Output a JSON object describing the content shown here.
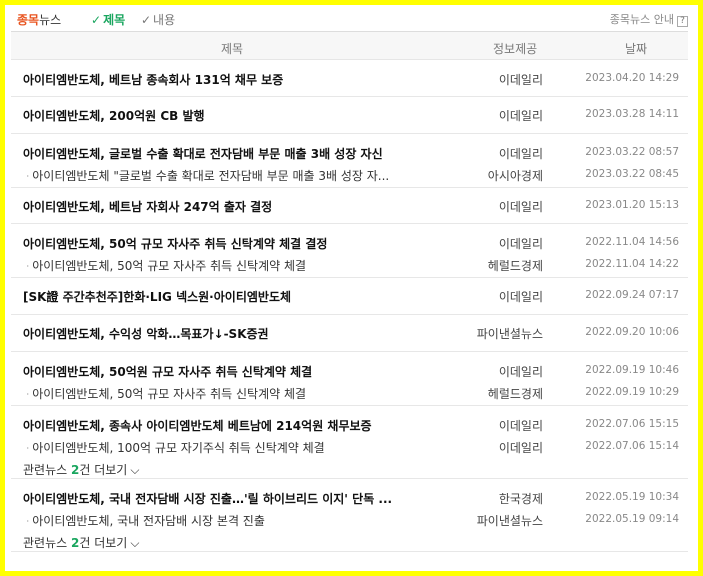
{
  "header": {
    "brand_strong": "종목",
    "brand_rest": "뉴스",
    "tabs": [
      {
        "label": "제목",
        "active": true
      },
      {
        "label": "내용",
        "active": false
      }
    ],
    "help_label": "종목뉴스 안내",
    "help_icon": "?"
  },
  "columns": {
    "title": "제목",
    "source": "정보제공",
    "date": "날짜"
  },
  "more_prefix": "관련뉴스",
  "more_suffix": "건 더보기",
  "chevron": "⌵",
  "sub_marker": "└",
  "check": "✓",
  "news": [
    {
      "title": "아이티엠반도체, 베트남 종속회사 131억 채무 보증",
      "source": "이데일리",
      "date": "2023.04.20 14:29",
      "related": [],
      "more": null
    },
    {
      "title": "아이티엠반도체, 200억원 CB 발행",
      "source": "이데일리",
      "date": "2023.03.28 14:11",
      "related": [],
      "more": null
    },
    {
      "title": "아이티엠반도체, 글로벌 수출 확대로 전자담배 부문 매출 3배 성장 자신",
      "source": "이데일리",
      "date": "2023.03.22 08:57",
      "related": [
        {
          "title": "아이티엠반도체 \"글로벌 수출 확대로 전자담배 부문 매출 3배 성장 자...",
          "source": "아시아경제",
          "date": "2023.03.22 08:45"
        }
      ],
      "more": null
    },
    {
      "title": "아이티엠반도체, 베트남 자회사 247억 출자 결정",
      "source": "이데일리",
      "date": "2023.01.20 15:13",
      "related": [],
      "more": null
    },
    {
      "title": "아이티엠반도체, 50억 규모 자사주 취득 신탁계약 체결 결정",
      "source": "이데일리",
      "date": "2022.11.04 14:56",
      "related": [
        {
          "title": "아이티엠반도체, 50억 규모 자사주 취득 신탁계약 체결",
          "source": "헤럴드경제",
          "date": "2022.11.04 14:22"
        }
      ],
      "more": null
    },
    {
      "title": "[SK證 주간추천주]한화·LIG 넥스원·아이티엠반도체",
      "source": "이데일리",
      "date": "2022.09.24 07:17",
      "related": [],
      "more": null
    },
    {
      "title": "아이티엠반도체, 수익성 악화…목표가↓-SK증권",
      "source": "파이낸셜뉴스",
      "date": "2022.09.20 10:06",
      "related": [],
      "more": null
    },
    {
      "title": "아이티엠반도체, 50억원 규모 자사주 취득 신탁계약 체결",
      "source": "이데일리",
      "date": "2022.09.19 10:46",
      "related": [
        {
          "title": "아이티엠반도체, 50억 규모 자사주 취득 신탁계약 체결",
          "source": "헤럴드경제",
          "date": "2022.09.19 10:29"
        }
      ],
      "more": null
    },
    {
      "title": "아이티엠반도체, 종속사 아이티엠반도체 베트남에 214억원 채무보증",
      "source": "이데일리",
      "date": "2022.07.06 15:15",
      "related": [
        {
          "title": "아이티엠반도체, 100억 규모 자기주식 취득 신탁계약 체결",
          "source": "이데일리",
          "date": "2022.07.06 15:14"
        }
      ],
      "more": "2"
    },
    {
      "title": "아이티엠반도체, 국내 전자담배 시장 진출…'릴 하이브리드 이지' 단독 ...",
      "source": "한국경제",
      "date": "2022.05.19 10:34",
      "related": [
        {
          "title": "아이티엠반도체, 국내 전자담배 시장 본격 진출",
          "source": "파이낸셜뉴스",
          "date": "2022.05.19 09:14"
        }
      ],
      "more": "2"
    }
  ]
}
